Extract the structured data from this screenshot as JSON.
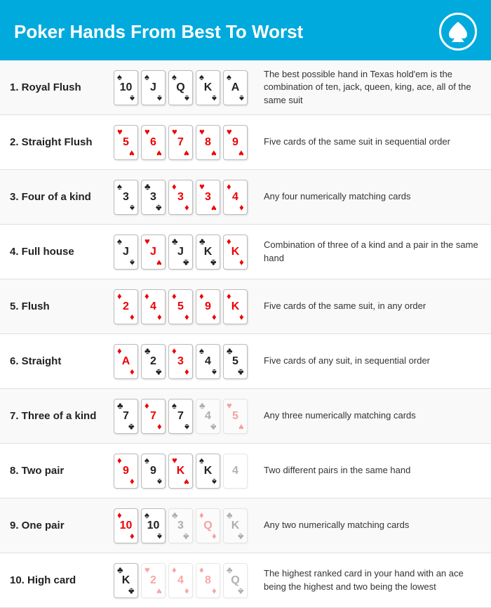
{
  "header": {
    "title": "Poker Hands From Best To Worst",
    "logo_symbol": "♠"
  },
  "hands": [
    {
      "number": "1",
      "name": "Royal Flush",
      "description": "The best possible hand in Texas hold'em is the combination of ten, jack, queen, king, ace, all of the same suit",
      "cards": [
        {
          "suit": "♠",
          "value": "10",
          "color": "black",
          "faded": false
        },
        {
          "suit": "♠",
          "value": "J",
          "color": "black",
          "faded": false
        },
        {
          "suit": "♠",
          "value": "Q",
          "color": "black",
          "faded": false
        },
        {
          "suit": "♠",
          "value": "K",
          "color": "black",
          "faded": false
        },
        {
          "suit": "♠",
          "value": "A",
          "color": "black",
          "faded": false
        }
      ]
    },
    {
      "number": "2",
      "name": "Straight Flush",
      "description": "Five cards of the same suit in sequential order",
      "cards": [
        {
          "suit": "♥",
          "value": "5",
          "color": "red",
          "faded": false
        },
        {
          "suit": "♥",
          "value": "6",
          "color": "red",
          "faded": false
        },
        {
          "suit": "♥",
          "value": "7",
          "color": "red",
          "faded": false
        },
        {
          "suit": "♥",
          "value": "8",
          "color": "red",
          "faded": false
        },
        {
          "suit": "♥",
          "value": "9",
          "color": "red",
          "faded": false
        }
      ]
    },
    {
      "number": "3",
      "name": "Four of a kind",
      "description": "Any four numerically matching cards",
      "cards": [
        {
          "suit": "♠",
          "value": "3",
          "color": "black",
          "faded": false
        },
        {
          "suit": "♣",
          "value": "3",
          "color": "black",
          "faded": false
        },
        {
          "suit": "♦",
          "value": "3",
          "color": "red",
          "faded": false
        },
        {
          "suit": "♥",
          "value": "3",
          "color": "red",
          "faded": false
        },
        {
          "suit": "♦",
          "value": "4",
          "color": "red",
          "faded": false
        }
      ]
    },
    {
      "number": "4",
      "name": "Full house",
      "description": "Combination of three of a kind and a pair in the same hand",
      "cards": [
        {
          "suit": "♠",
          "value": "J",
          "color": "black",
          "faded": false
        },
        {
          "suit": "♥",
          "value": "J",
          "color": "red",
          "faded": false
        },
        {
          "suit": "♣",
          "value": "J",
          "color": "black",
          "faded": false
        },
        {
          "suit": "♣",
          "value": "K",
          "color": "black",
          "faded": false
        },
        {
          "suit": "♦",
          "value": "K",
          "color": "red",
          "faded": false
        }
      ]
    },
    {
      "number": "5",
      "name": "Flush",
      "description": "Five cards of the same suit, in any order",
      "cards": [
        {
          "suit": "♦",
          "value": "2",
          "color": "red",
          "faded": false
        },
        {
          "suit": "♦",
          "value": "4",
          "color": "red",
          "faded": false
        },
        {
          "suit": "♦",
          "value": "5",
          "color": "red",
          "faded": false
        },
        {
          "suit": "♦",
          "value": "9",
          "color": "red",
          "faded": false
        },
        {
          "suit": "♦",
          "value": "K",
          "color": "red",
          "faded": false
        }
      ]
    },
    {
      "number": "6",
      "name": "Straight",
      "description": "Five cards of any suit, in sequential order",
      "cards": [
        {
          "suit": "♦",
          "value": "A",
          "color": "red",
          "faded": false
        },
        {
          "suit": "♣",
          "value": "2",
          "color": "black",
          "faded": false
        },
        {
          "suit": "♦",
          "value": "3",
          "color": "red",
          "faded": false
        },
        {
          "suit": "♠",
          "value": "4",
          "color": "black",
          "faded": false
        },
        {
          "suit": "♣",
          "value": "5",
          "color": "black",
          "faded": false
        }
      ]
    },
    {
      "number": "7",
      "name": "Three of a kind",
      "description": "Any three numerically matching cards",
      "cards": [
        {
          "suit": "♣",
          "value": "7",
          "color": "black",
          "faded": false
        },
        {
          "suit": "♦",
          "value": "7",
          "color": "red",
          "faded": false
        },
        {
          "suit": "♠",
          "value": "7",
          "color": "black",
          "faded": false
        },
        {
          "suit": "♣",
          "value": "4",
          "color": "black",
          "faded": true
        },
        {
          "suit": "♥",
          "value": "5",
          "color": "red",
          "faded": true
        }
      ]
    },
    {
      "number": "8",
      "name": "Two pair",
      "description": "Two different pairs in the same hand",
      "cards": [
        {
          "suit": "♦",
          "value": "9",
          "color": "red",
          "faded": false
        },
        {
          "suit": "♠",
          "value": "9",
          "color": "black",
          "faded": false
        },
        {
          "suit": "♥",
          "value": "K",
          "color": "red",
          "faded": false
        },
        {
          "suit": "♠",
          "value": "K",
          "color": "black",
          "faded": false
        },
        {
          "suit": "",
          "value": "4",
          "color": "black",
          "faded": true
        }
      ]
    },
    {
      "number": "9",
      "name": "One pair",
      "description": "Any two numerically matching cards",
      "cards": [
        {
          "suit": "♦",
          "value": "10",
          "color": "red",
          "faded": false
        },
        {
          "suit": "♠",
          "value": "10",
          "color": "black",
          "faded": false
        },
        {
          "suit": "♣",
          "value": "3",
          "color": "black",
          "faded": true
        },
        {
          "suit": "♦",
          "value": "Q",
          "color": "red",
          "faded": true
        },
        {
          "suit": "♣",
          "value": "K",
          "color": "black",
          "faded": true
        }
      ]
    },
    {
      "number": "10",
      "name": "High card",
      "description": "The highest ranked card in your hand with an ace being the highest and two being the lowest",
      "cards": [
        {
          "suit": "♣",
          "value": "K",
          "color": "black",
          "faded": false
        },
        {
          "suit": "♥",
          "value": "2",
          "color": "red",
          "faded": true
        },
        {
          "suit": "♦",
          "value": "4",
          "color": "red",
          "faded": true
        },
        {
          "suit": "♦",
          "value": "8",
          "color": "red",
          "faded": true
        },
        {
          "suit": "♣",
          "value": "Q",
          "color": "black",
          "faded": true
        }
      ]
    }
  ]
}
